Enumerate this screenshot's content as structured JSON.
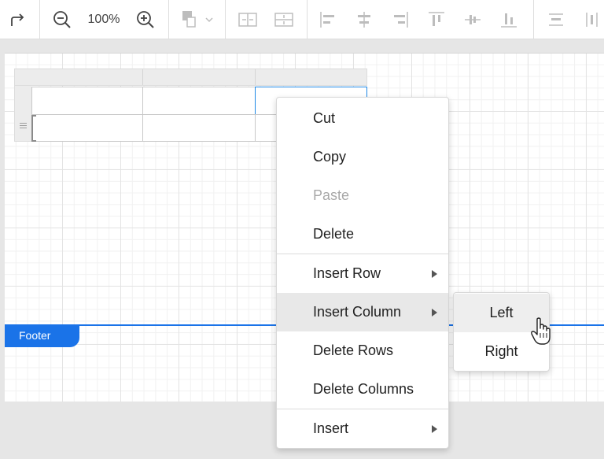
{
  "toolbar": {
    "zoom_level": "100%",
    "icons": [
      "redo-icon",
      "zoom-out-icon",
      "zoom-in-icon",
      "fill-color-icon",
      "merge-cells-horizontal-icon",
      "merge-cells-vertical-icon",
      "align-left-icon",
      "align-center-icon",
      "align-right-icon",
      "align-top-icon",
      "align-middle-icon",
      "align-bottom-icon",
      "distribute-horizontal-icon",
      "distribute-vertical-icon"
    ]
  },
  "canvas": {
    "footer_label": "Footer"
  },
  "context_menu": {
    "items": [
      {
        "label": "Cut",
        "enabled": true
      },
      {
        "label": "Copy",
        "enabled": true
      },
      {
        "label": "Paste",
        "enabled": false
      },
      {
        "label": "Delete",
        "enabled": true
      },
      {
        "label": "Insert Row",
        "enabled": true,
        "submenu": true
      },
      {
        "label": "Insert Column",
        "enabled": true,
        "submenu": true,
        "highlighted": true
      },
      {
        "label": "Delete Rows",
        "enabled": true
      },
      {
        "label": "Delete Columns",
        "enabled": true
      },
      {
        "label": "Insert",
        "enabled": true,
        "submenu": true
      }
    ]
  },
  "submenu": {
    "items": [
      {
        "label": "Left",
        "highlighted": true
      },
      {
        "label": "Right"
      }
    ]
  },
  "colors": {
    "accent": "#1a73e8",
    "selection": "#1e88e5",
    "menu_hover": "#e8e8e8"
  }
}
